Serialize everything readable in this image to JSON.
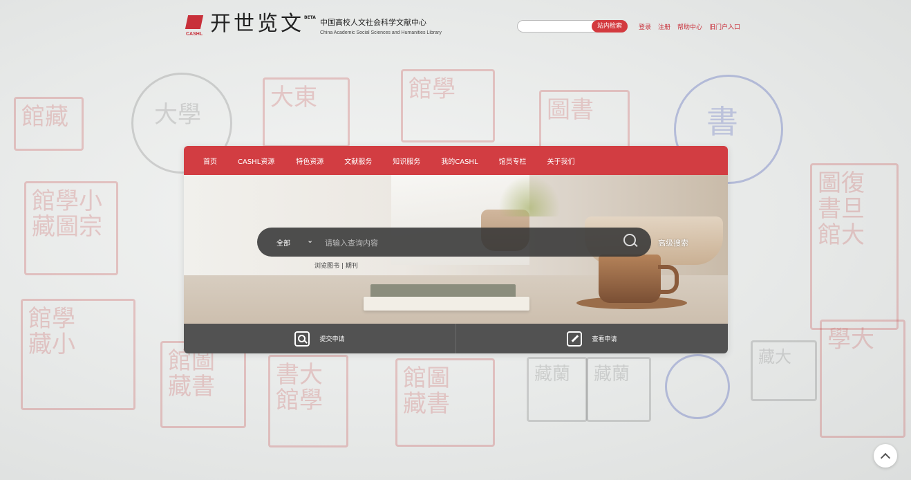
{
  "header": {
    "logo_cn": "开世览文",
    "logo_beta": "BETA",
    "logo_abbr": "CASHL",
    "subtitle_cn": "中国高校人文社会科学文献中心",
    "subtitle_en": "China Academic Social Sciences and Humanities Library",
    "site_search_button": "站内检索",
    "links": [
      "登录",
      "注册",
      "帮助中心",
      "旧门户入口"
    ]
  },
  "nav": [
    "首页",
    "CASHL资源",
    "特色资源",
    "文献服务",
    "知识服务",
    "我的CASHL",
    "馆员专栏",
    "关于我们"
  ],
  "search": {
    "scope": "全部",
    "placeholder": "请输入查询内容",
    "advanced": "高级搜索",
    "browse_books": "浏览图书",
    "browse_sep": "|",
    "browse_journals": "期刊"
  },
  "actions": {
    "submit": "提交申请",
    "view": "查看申请"
  },
  "colors": {
    "brand_red": "#d23d42",
    "dark_bar": "#525252"
  }
}
